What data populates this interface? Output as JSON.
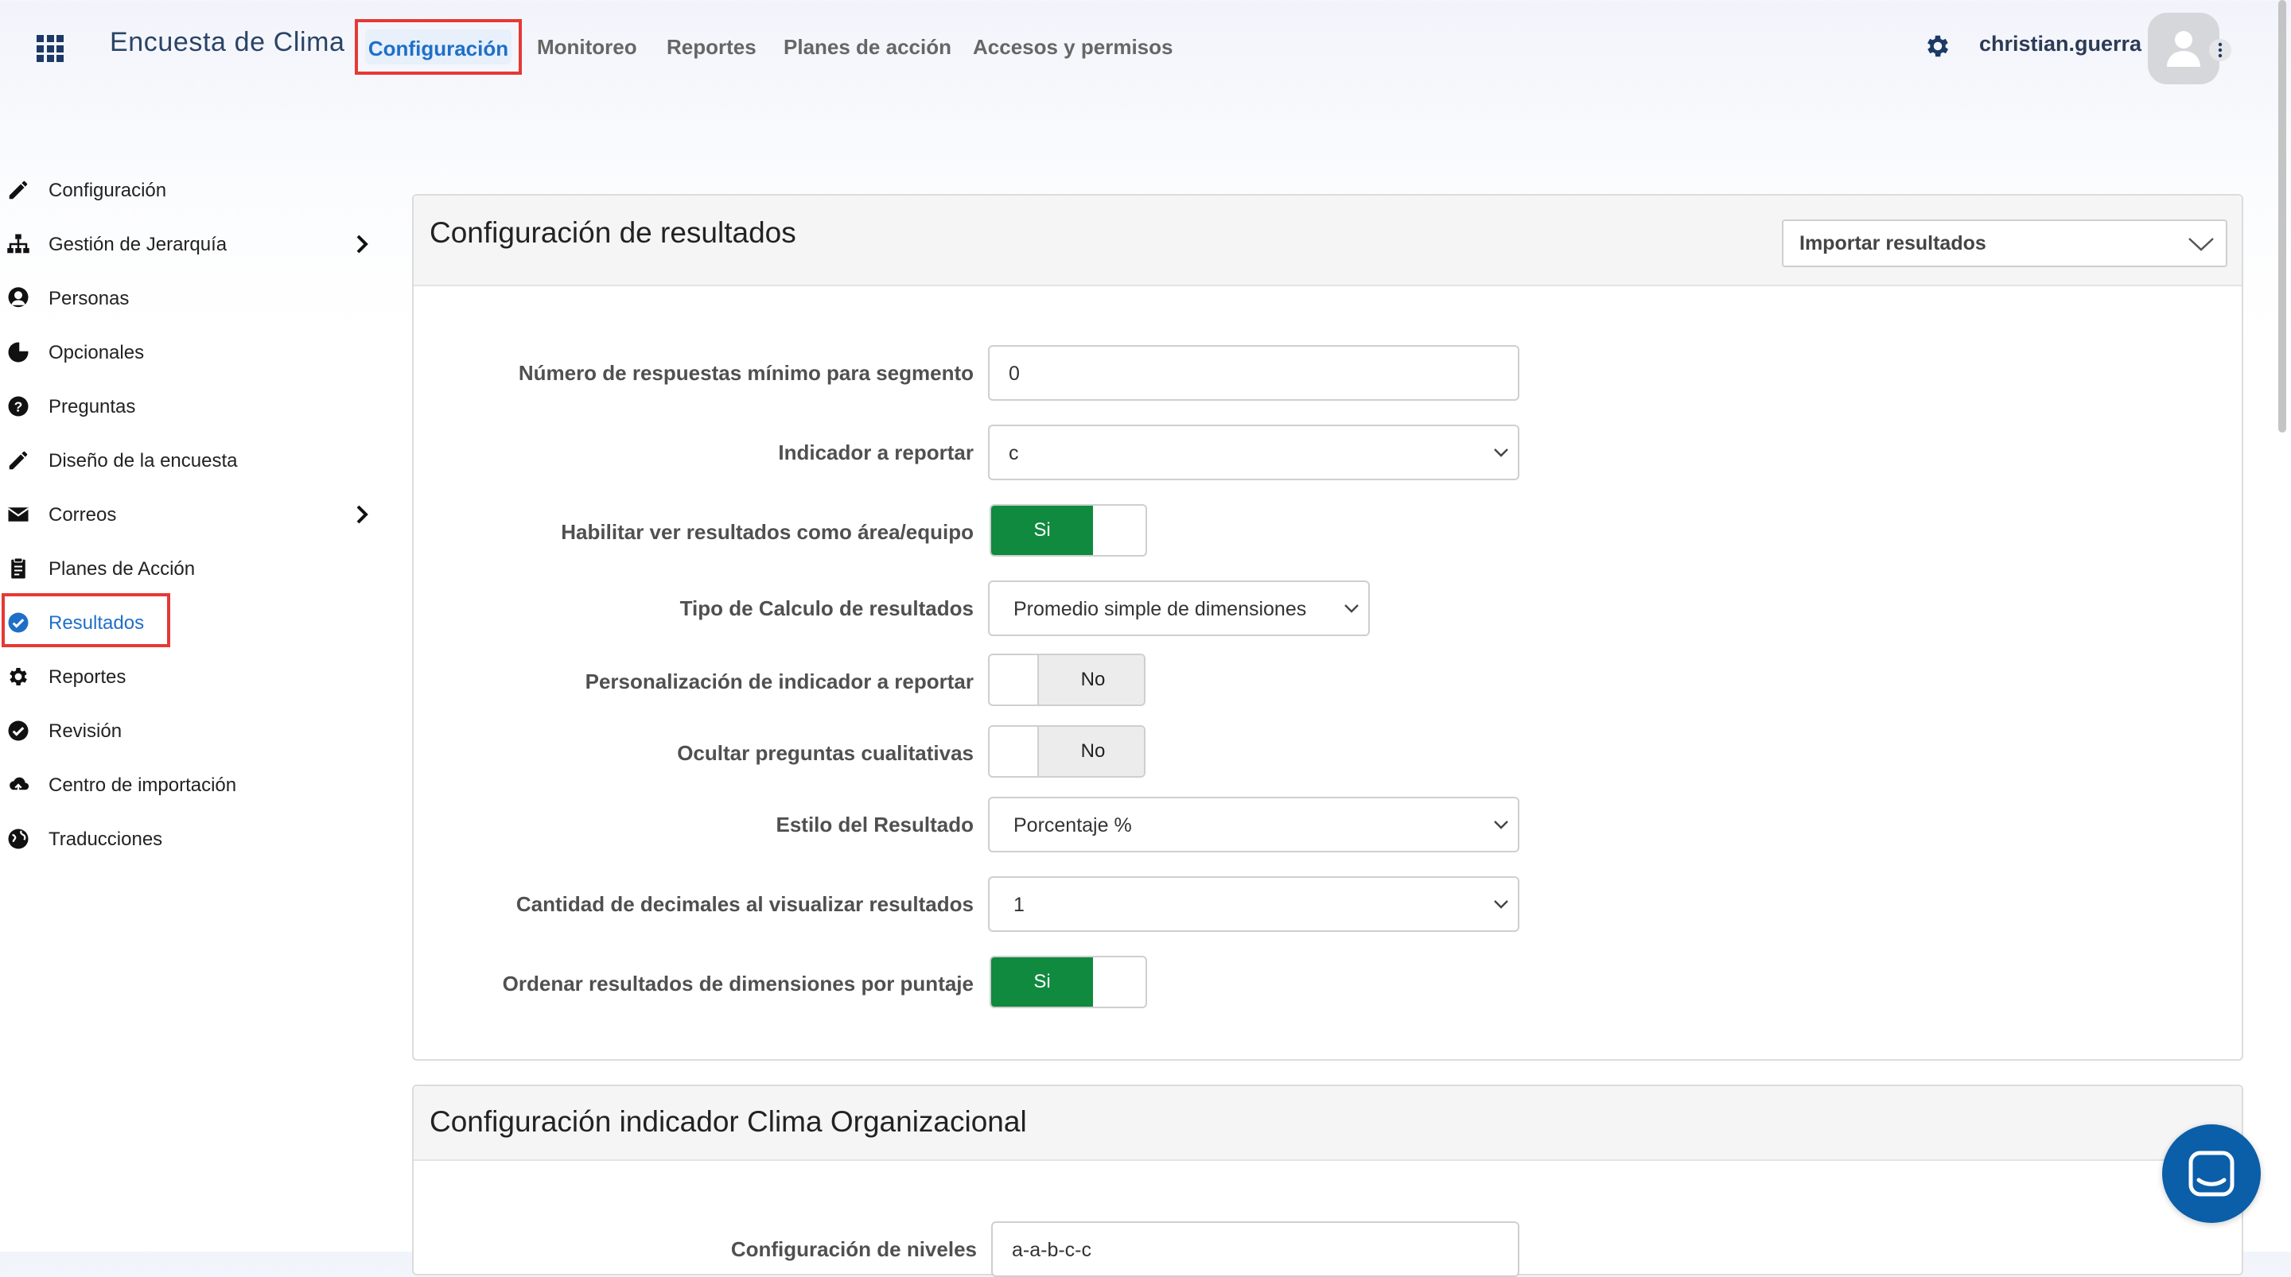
{
  "header": {
    "app_title": "Encuesta de Clima",
    "nav": [
      "Configuración",
      "Monitoreo",
      "Reportes",
      "Planes de acción",
      "Accesos y permisos"
    ],
    "active_nav": "Configuración",
    "user_name": "christian.guerra"
  },
  "sidebar": {
    "items": [
      {
        "label": "Configuración",
        "icon": "pencil-icon"
      },
      {
        "label": "Gestión de Jerarquía",
        "icon": "hierarchy-icon",
        "has_submenu": true
      },
      {
        "label": "Personas",
        "icon": "person-icon"
      },
      {
        "label": "Opcionales",
        "icon": "pie-chart-icon"
      },
      {
        "label": "Preguntas",
        "icon": "question-icon"
      },
      {
        "label": "Diseño de la encuesta",
        "icon": "pencil-icon"
      },
      {
        "label": "Correos",
        "icon": "envelope-icon",
        "has_submenu": true
      },
      {
        "label": "Planes de Acción",
        "icon": "clipboard-icon"
      },
      {
        "label": "Resultados",
        "icon": "check-circle-icon",
        "active": true
      },
      {
        "label": "Reportes",
        "icon": "gear-icon"
      },
      {
        "label": "Revisión",
        "icon": "check-circle-icon"
      },
      {
        "label": "Centro de importación",
        "icon": "cloud-upload-icon"
      },
      {
        "label": "Traducciones",
        "icon": "globe-icon"
      }
    ]
  },
  "results_panel": {
    "title": "Configuración de resultados",
    "import_label": "Importar resultados",
    "fields": {
      "min_responses": {
        "label": "Número de respuestas mínimo para segmento",
        "value": "0"
      },
      "indicator": {
        "label": "Indicador a reportar",
        "value": "c"
      },
      "area_results": {
        "label": "Habilitar ver resultados como área/equipo",
        "value": "Si"
      },
      "calc_type": {
        "label": "Tipo de Calculo de resultados",
        "value": "Promedio simple de dimensiones"
      },
      "custom_indicator": {
        "label": "Personalización de indicador a reportar",
        "value": "No"
      },
      "hide_qualitative": {
        "label": "Ocultar preguntas cualitativas",
        "value": "No"
      },
      "result_style": {
        "label": "Estilo del Resultado",
        "value": "Porcentaje %"
      },
      "decimals": {
        "label": "Cantidad de decimales al visualizar resultados",
        "value": "1"
      },
      "sort_by_score": {
        "label": "Ordenar resultados de dimensiones por puntaje",
        "value": "Si"
      }
    }
  },
  "climate_panel": {
    "title": "Configuración indicador Clima Organizacional",
    "levels_label": "Configuración de niveles",
    "levels_value": "a-a-b-c-c"
  },
  "colors": {
    "accent": "#1f6fc8",
    "toggle_on": "#0f8a3e",
    "highlight": "#e53935",
    "chat": "#0b5ea8"
  }
}
